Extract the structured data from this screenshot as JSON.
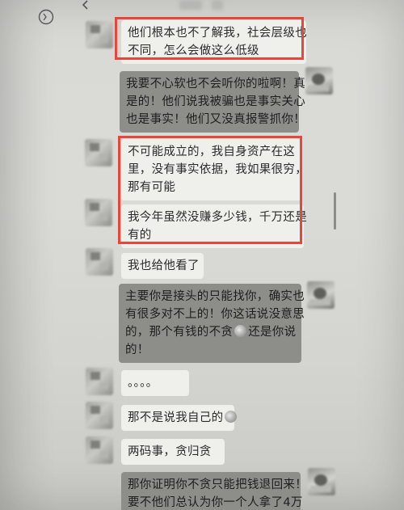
{
  "chat": {
    "messages": [
      {
        "side": "in",
        "lines": [
          "他们根本也不了解我，社会层级也",
          "不同，怎么会做这么低级"
        ]
      },
      {
        "side": "out",
        "lines": [
          "我要不心软也不会听你的啦啊！真",
          "是的！他们说我被骗也是事实关心",
          "也是事实！他们又没真报警抓你！"
        ]
      },
      {
        "side": "in",
        "lines": [
          "不可能成立的，我自身资产在这",
          "里，没有事实依据，我如果很穷，",
          "那有可能"
        ]
      },
      {
        "side": "in",
        "lines": [
          "我今年虽然没赚多少钱，千万还是",
          "有的"
        ]
      },
      {
        "side": "in",
        "lines": [
          "我也给他看了"
        ]
      },
      {
        "side": "out",
        "lines": [
          "主要你是接头的只能找你，确实也",
          "有很多对不上的！你这话说没意思",
          "的，那个有钱的不贪",
          "还是你说",
          "的！"
        ]
      },
      {
        "side": "in",
        "lines": [
          "。。。。"
        ]
      },
      {
        "side": "in",
        "lines": [
          "那不是说我自己的"
        ]
      },
      {
        "side": "in",
        "lines": [
          "两码事，贪归贪"
        ]
      },
      {
        "side": "out",
        "lines": [
          "那你证明你不贪只能把钱退回来！",
          "要不他们总认为你一个人拿了4万"
        ]
      }
    ]
  },
  "icons": {
    "back": "chevron-left-icon",
    "clock": "circle-icon",
    "emoji": "emoji-face-icon"
  },
  "colors": {
    "highlight_box": "#e8463a",
    "incoming_bubble": "#efefec",
    "outgoing_bubble": "#8d8d8a"
  }
}
